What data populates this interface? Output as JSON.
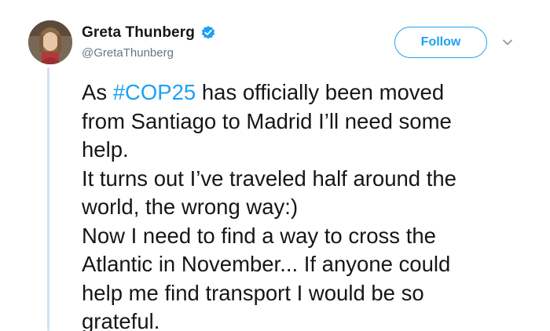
{
  "author": {
    "display_name": "Greta Thunberg",
    "handle": "@GretaThunberg",
    "verified_icon": "verified-badge-icon",
    "avatar_icon": "profile-photo"
  },
  "actions": {
    "follow_label": "Follow",
    "more_icon": "chevron-down-icon"
  },
  "tweet": {
    "lines": [
      {
        "before": "As ",
        "hashtag": "#COP25",
        "after": " has officially been moved"
      },
      {
        "text": "from Santiago to Madrid I’ll need some"
      },
      {
        "text": "help."
      },
      {
        "text": "It turns out I’ve traveled half around the"
      },
      {
        "text": "world, the wrong way:)"
      },
      {
        "text": "Now I need to find a way to cross the"
      },
      {
        "text": "Atlantic in November... If anyone could"
      },
      {
        "text": "help me find transport I would be so"
      },
      {
        "text": "grateful."
      }
    ]
  },
  "colors": {
    "accent": "#1da1f2",
    "text": "#14171a",
    "secondary": "#657786",
    "thread_line": "#cfe3f2"
  }
}
